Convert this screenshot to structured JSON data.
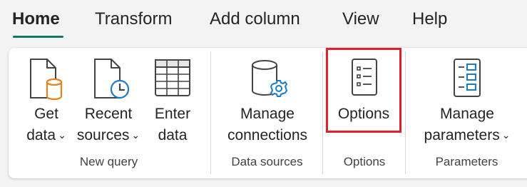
{
  "tabs": [
    {
      "label": "Home",
      "active": true
    },
    {
      "label": "Transform",
      "active": false
    },
    {
      "label": "Add column",
      "active": false
    },
    {
      "label": "View",
      "active": false
    },
    {
      "label": "Help",
      "active": false
    }
  ],
  "ribbon": {
    "new_query": {
      "group_label": "New query",
      "get_data": {
        "line1": "Get",
        "line2": "data",
        "chevron": "⌄",
        "icon": "document-database-icon"
      },
      "recent_sources": {
        "line1": "Recent",
        "line2": "sources",
        "chevron": "⌄",
        "icon": "document-clock-icon"
      },
      "enter_data": {
        "line1": "Enter",
        "line2": "data",
        "icon": "table-icon"
      }
    },
    "data_sources": {
      "group_label": "Data sources",
      "manage_connections": {
        "line1": "Manage",
        "line2": "connections",
        "icon": "database-gear-icon"
      }
    },
    "options": {
      "group_label": "Options",
      "options_button": {
        "label": "Options",
        "icon": "checklist-icon"
      },
      "highlight_color": "#e0202c"
    },
    "parameters": {
      "group_label": "Parameters",
      "manage_parameters": {
        "line1": "Manage",
        "line2": "parameters",
        "chevron": "⌄",
        "icon": "parameters-list-icon"
      }
    }
  },
  "colors": {
    "accent_underline": "#117865",
    "icon_orange": "#e8821e",
    "icon_blue": "#1a7cc4"
  }
}
